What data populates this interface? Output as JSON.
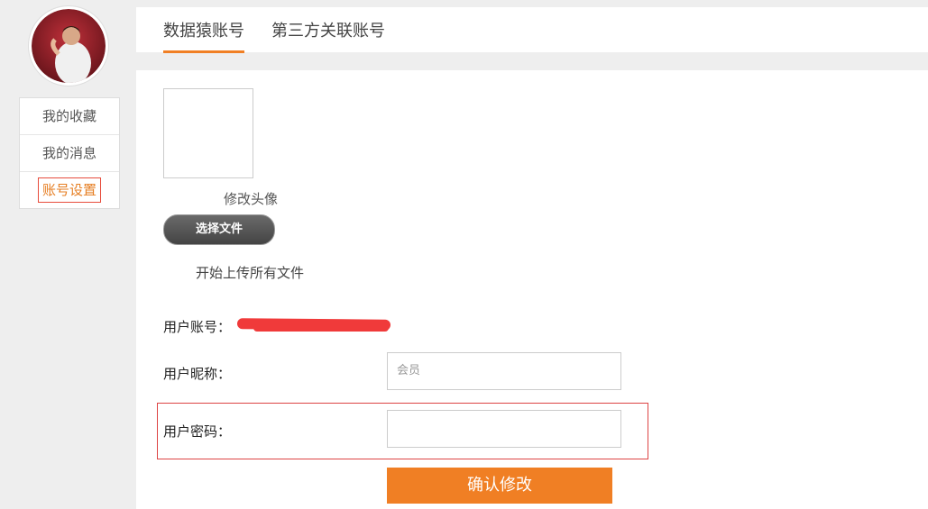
{
  "sidebar": {
    "items": [
      {
        "label": "我的收藏"
      },
      {
        "label": "我的消息"
      },
      {
        "label": "账号设置"
      }
    ]
  },
  "tabs": [
    {
      "label": "数据猿账号"
    },
    {
      "label": "第三方关联账号"
    }
  ],
  "avatar_section": {
    "caption": "修改头像",
    "choose_file": "选择文件",
    "upload_all": "开始上传所有文件"
  },
  "form": {
    "account_label": "用户账号：",
    "nickname_label": "用户昵称：",
    "nickname_placeholder": "会员",
    "password_label": "用户密码：",
    "submit_label": "确认修改"
  },
  "colors": {
    "accent": "#f07f24",
    "highlight_border": "#d44444"
  }
}
